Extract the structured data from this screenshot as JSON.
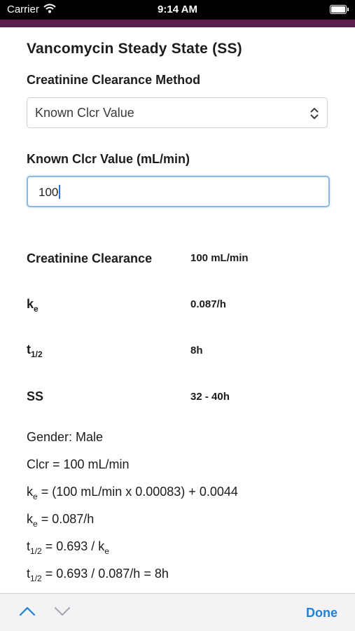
{
  "status_bar": {
    "carrier": "Carrier",
    "time": "9:14 AM"
  },
  "accent_color": "#5a1f4c",
  "page": {
    "title": "Vancomycin Steady State (SS)",
    "method_label": "Creatinine Clearance Method",
    "method_value": "Known Clcr Value",
    "known_label": "Known Clcr Value (mL/min)",
    "known_value": "100"
  },
  "results": {
    "crcl": {
      "label": "Creatinine Clearance",
      "value": "100 mL/min"
    },
    "ke": {
      "label": "k",
      "sub": "e",
      "value": "0.087/h"
    },
    "thalf": {
      "label": "t",
      "sub": "1/2",
      "value": "8h"
    },
    "ss": {
      "label": "SS",
      "value": "32 - 40h"
    }
  },
  "formulas": {
    "gender": "Gender: Male",
    "clcr": "Clcr = 100 mL/min",
    "ke_calc_k": "k",
    "ke_calc_sub": "e",
    "ke_calc_rest": " = (100 mL/min x 0.00083) + 0.0044",
    "ke_val_k": "k",
    "ke_val_sub": "e",
    "ke_val_rest": " = 0.087/h",
    "th1_t": "t",
    "th1_sub": "1/2",
    "th1_mid": " = 0.693 / k",
    "th1_sub2": "e",
    "th2_t": "t",
    "th2_sub": "1/2",
    "th2_rest": " = 0.693 / 0.087/h = 8h"
  },
  "toolbar": {
    "done_label": "Done",
    "tint": "#1e7fdc"
  }
}
